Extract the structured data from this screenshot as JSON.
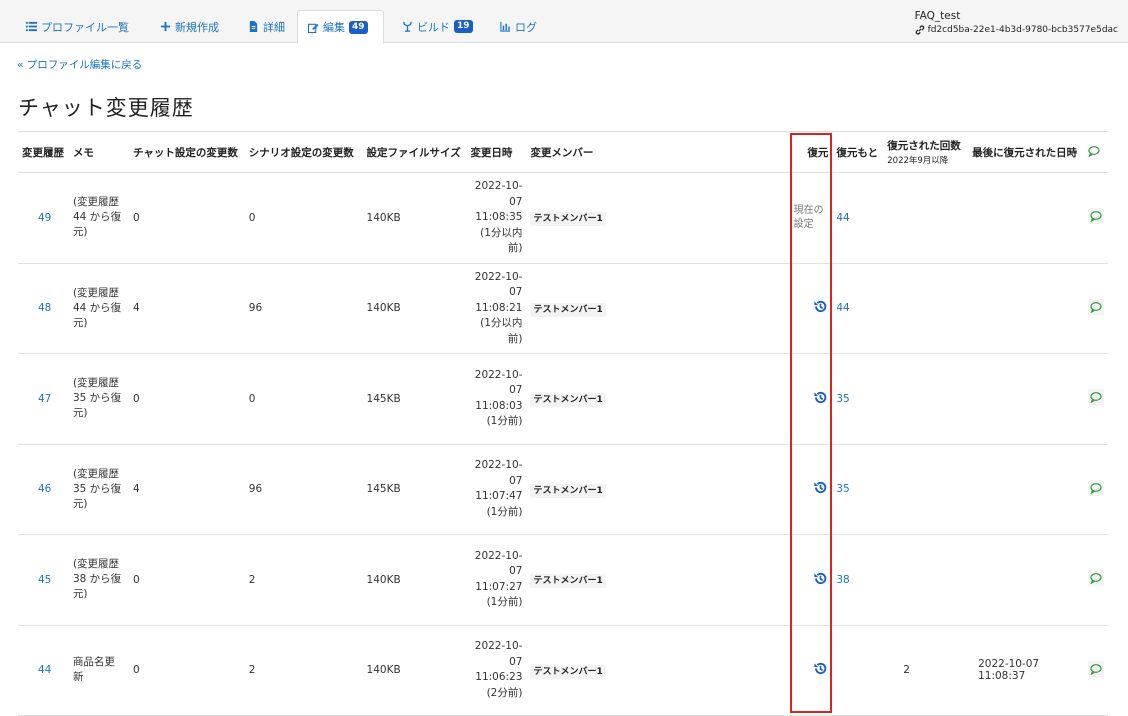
{
  "nav": {
    "tabs": [
      {
        "label": "プロファイル一覧",
        "badge": ""
      },
      {
        "label": "新規作成",
        "badge": ""
      },
      {
        "label": "詳細",
        "badge": ""
      },
      {
        "label": "編集",
        "badge": "49"
      },
      {
        "label": "ビルド",
        "badge": "19"
      },
      {
        "label": "ログ",
        "badge": ""
      }
    ]
  },
  "profile": {
    "name": "FAQ_test",
    "id": "fd2cd5ba-22e1-4b3d-9780-bcb3577e5dac"
  },
  "back_link": "« プロファイル編集に戻る",
  "page_title": "チャット変更履歴",
  "table": {
    "headers": {
      "history": "変更履歴",
      "memo": "メモ",
      "chat_changes": "チャット設定の変更数",
      "scenario_changes": "シナリオ設定の変更数",
      "file_size": "設定ファイルサイズ",
      "changed_at": "変更日時",
      "member": "変更メンバー",
      "restore": "復元",
      "restore_source": "復元もと",
      "restore_count": "復元された回数",
      "restore_count_sub": "2022年9月以降",
      "last_restored": "最後に復元された日時"
    },
    "rows": [
      {
        "id": "49",
        "memo": "(変更履歴 44 から復元)",
        "chat": "0",
        "scenario": "0",
        "size": "140KB",
        "date": "2022-10-07",
        "time": "11:08:35",
        "ago": "(1分以内前)",
        "member": "テストメンバー1",
        "restore": "現在の設定",
        "source": "44",
        "count": "",
        "last": ""
      },
      {
        "id": "48",
        "memo": "(変更履歴 44 から復元)",
        "chat": "4",
        "scenario": "96",
        "size": "140KB",
        "date": "2022-10-07",
        "time": "11:08:21",
        "ago": "(1分以内前)",
        "member": "テストメンバー1",
        "restore": "",
        "source": "44",
        "count": "",
        "last": ""
      },
      {
        "id": "47",
        "memo": "(変更履歴 35 から復元)",
        "chat": "0",
        "scenario": "0",
        "size": "145KB",
        "date": "2022-10-07",
        "time": "11:08:03",
        "ago": "(1分前)",
        "member": "テストメンバー1",
        "restore": "",
        "source": "35",
        "count": "",
        "last": ""
      },
      {
        "id": "46",
        "memo": "(変更履歴 35 から復元)",
        "chat": "4",
        "scenario": "96",
        "size": "145KB",
        "date": "2022-10-07",
        "time": "11:07:47",
        "ago": "(1分前)",
        "member": "テストメンバー1",
        "restore": "",
        "source": "35",
        "count": "",
        "last": ""
      },
      {
        "id": "45",
        "memo": "(変更履歴 38 から復元)",
        "chat": "0",
        "scenario": "2",
        "size": "140KB",
        "date": "2022-10-07",
        "time": "11:07:27",
        "ago": "(1分前)",
        "member": "テストメンバー1",
        "restore": "",
        "source": "38",
        "count": "",
        "last": ""
      },
      {
        "id": "44",
        "memo": "商品名更新",
        "chat": "0",
        "scenario": "2",
        "size": "140KB",
        "date": "2022-10-07",
        "time": "11:06:23",
        "ago": "(2分前)",
        "member": "テストメンバー1",
        "restore": "",
        "source": "",
        "count": "2",
        "last": "2022-10-07 11:08:37"
      }
    ]
  },
  "colors": {
    "link": "#1a73c8",
    "badge": "#1a5fc8",
    "restore_icon": "#1a5fc8",
    "comment_icon": "#2e9a3a",
    "highlight_box": "#d9251d"
  }
}
